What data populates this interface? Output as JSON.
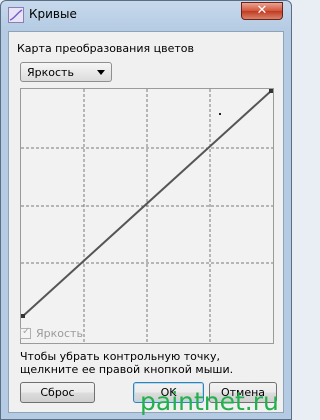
{
  "window": {
    "title": "Кривые",
    "close_symbol": "✕"
  },
  "map_label": "Карта преобразования цветов",
  "dropdown": {
    "selected": "Яркость"
  },
  "checkbox": {
    "label": "Яркость",
    "checked": true,
    "enabled": false,
    "check_symbol": "✓"
  },
  "hint": "Чтобы убрать контрольную точку, щелкните ее правой кнопкой мыши.",
  "buttons": {
    "reset": "Сброс",
    "ok": "OK",
    "cancel": "Отмена"
  },
  "watermark": "paintnet.ru",
  "curve": {
    "start": [
      0,
      0
    ],
    "end": [
      255,
      255
    ]
  },
  "colors": {
    "curve": "#555555",
    "grid": "#7a7a7a",
    "watermark": "#22b14c"
  }
}
